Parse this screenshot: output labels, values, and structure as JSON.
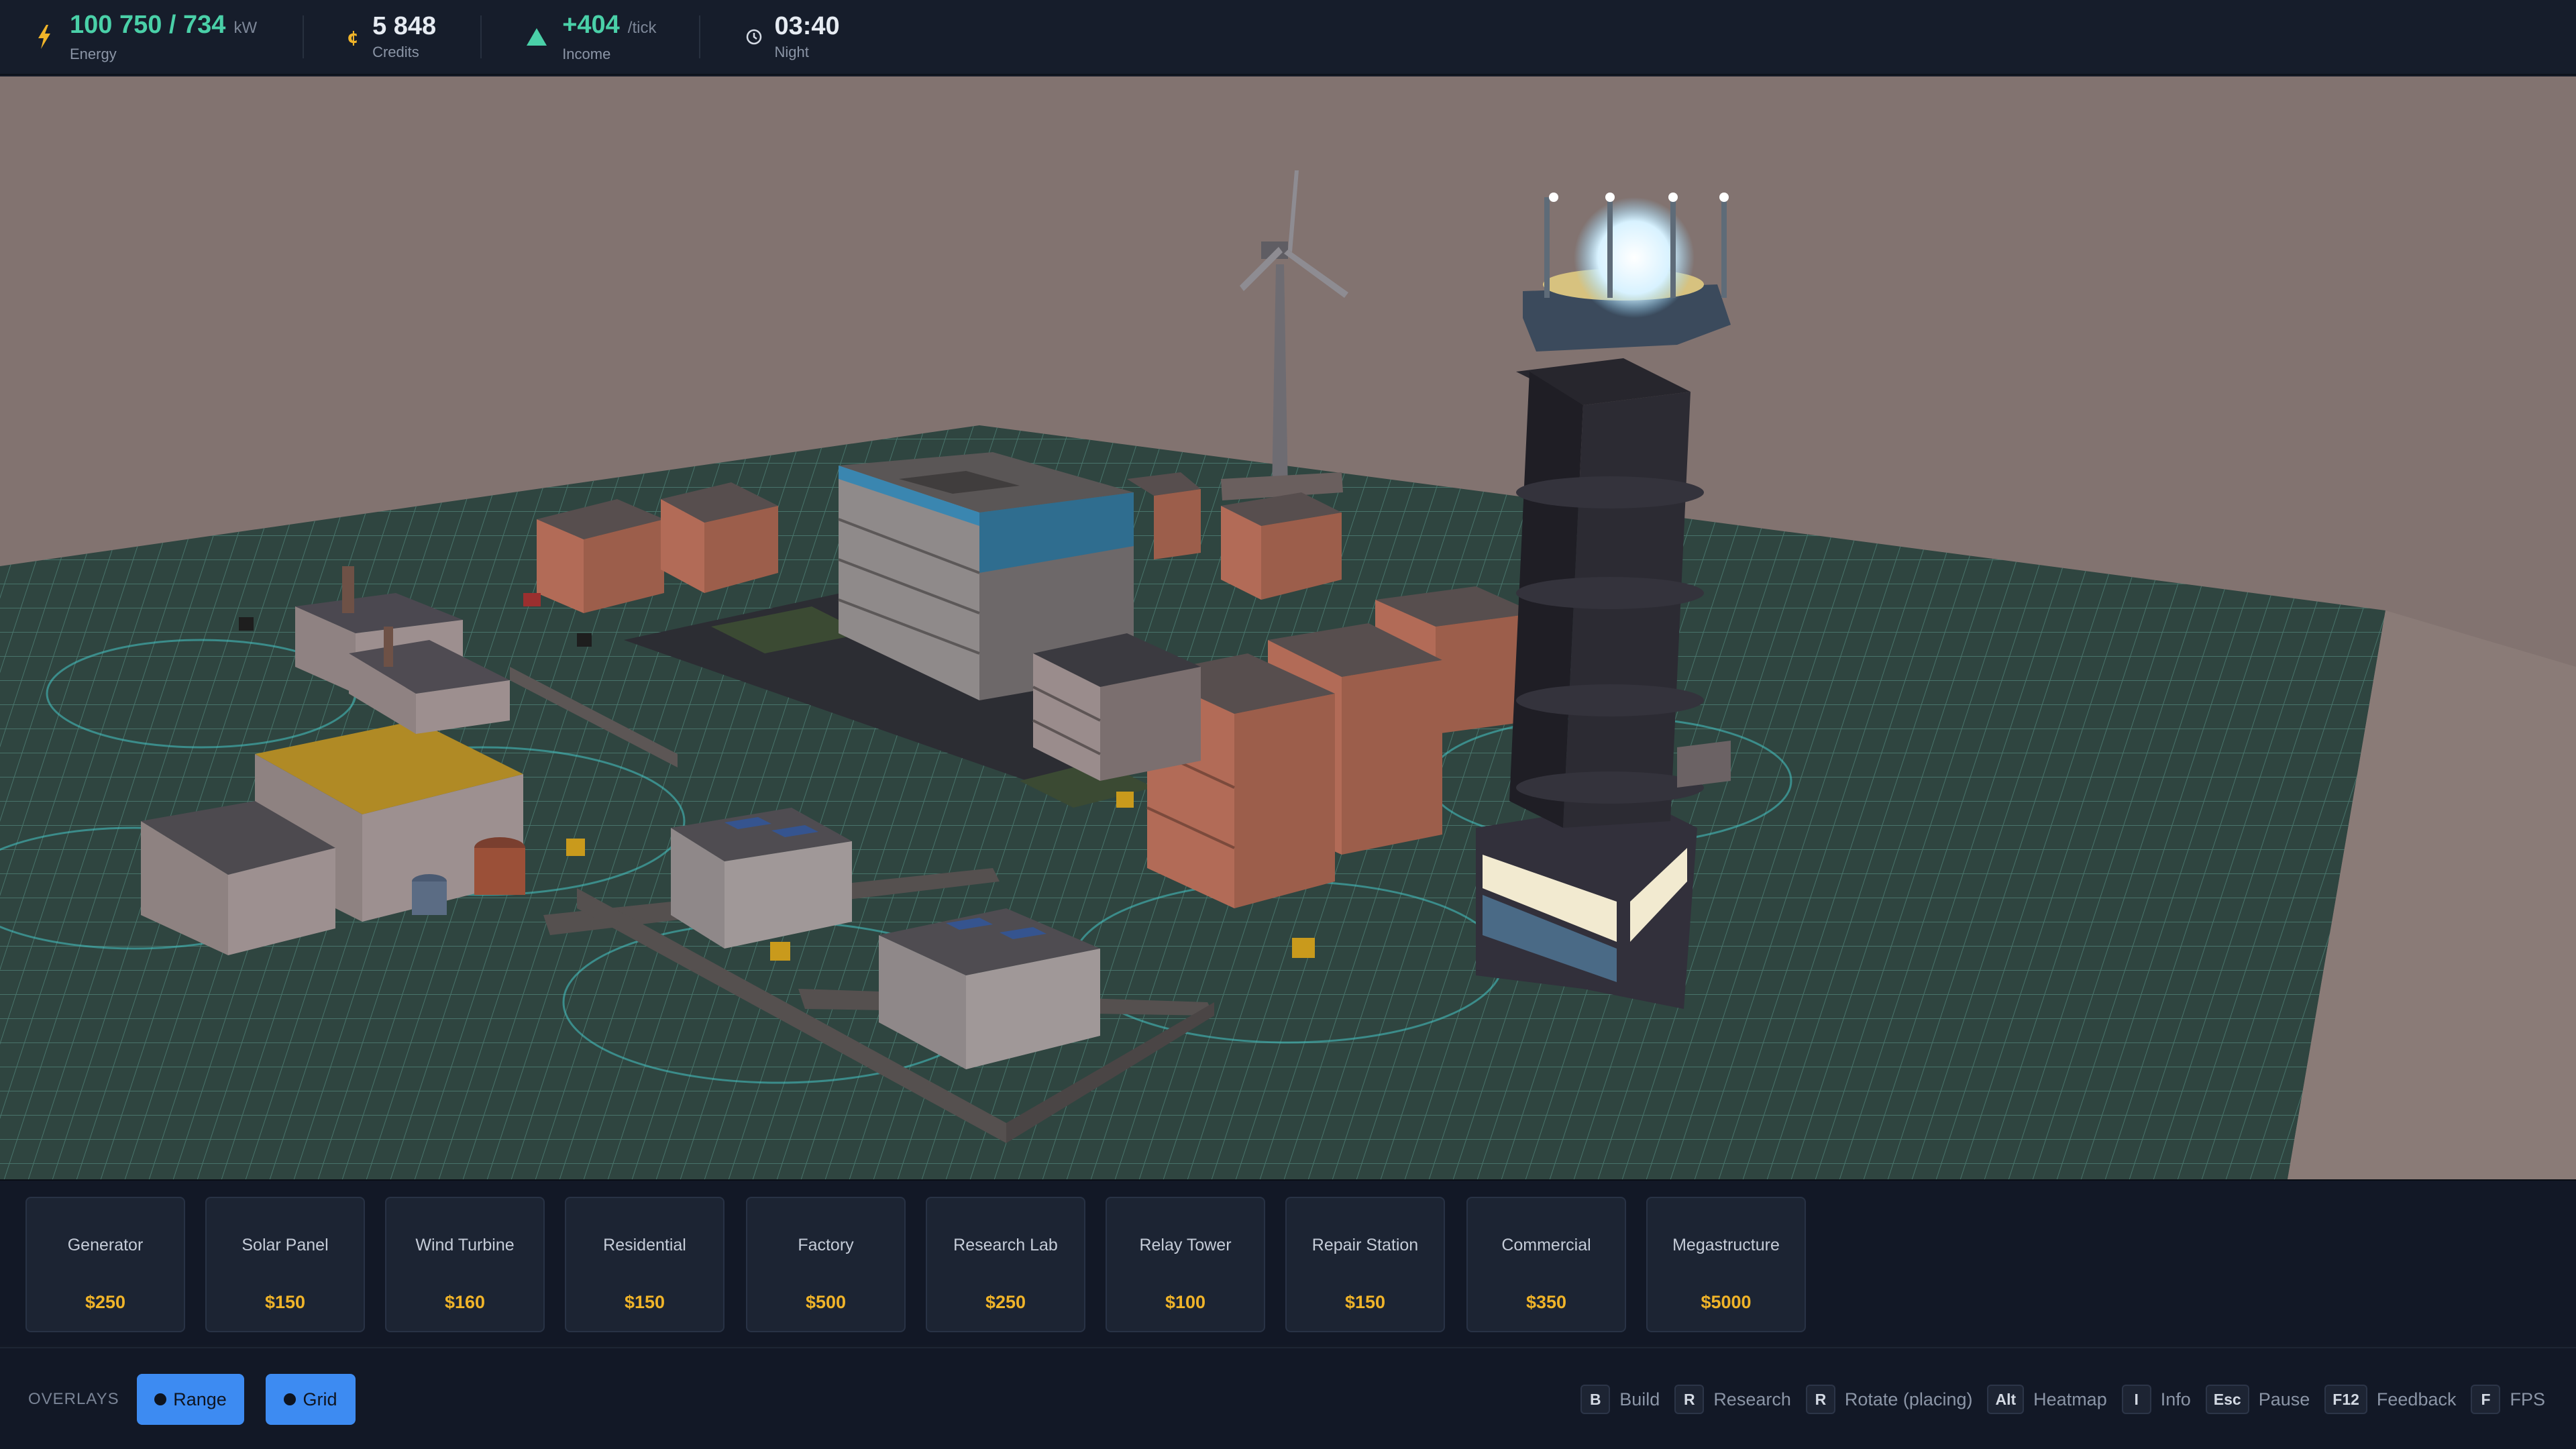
{
  "hud": {
    "energy": {
      "value": "100 750 / 734",
      "unit": "kW",
      "label": "Energy",
      "icon": "lightning-icon"
    },
    "credits": {
      "value": "5 848",
      "label": "Credits",
      "icon": "coin-icon"
    },
    "income": {
      "value": "+404",
      "unit": "/tick",
      "label": "Income",
      "icon": "up-triangle-icon"
    },
    "time": {
      "value": "03:40",
      "label": "Night",
      "icon": "clock-icon"
    }
  },
  "build_menu": [
    {
      "name": "Generator",
      "price": "$250"
    },
    {
      "name": "Solar Panel",
      "price": "$150"
    },
    {
      "name": "Wind Turbine",
      "price": "$160"
    },
    {
      "name": "Residential",
      "price": "$150"
    },
    {
      "name": "Factory",
      "price": "$500"
    },
    {
      "name": "Research Lab",
      "price": "$250"
    },
    {
      "name": "Relay Tower",
      "price": "$100"
    },
    {
      "name": "Repair Station",
      "price": "$150"
    },
    {
      "name": "Commercial",
      "price": "$350"
    },
    {
      "name": "Megastructure",
      "price": "$5000"
    }
  ],
  "overlays": {
    "label": "OVERLAYS",
    "range": "Range",
    "grid": "Grid"
  },
  "shortcuts": [
    {
      "key": "B",
      "label": "Build"
    },
    {
      "key": "R",
      "label": "Research"
    },
    {
      "key": "R",
      "label": "Rotate (placing)"
    },
    {
      "key": "Alt",
      "label": "Heatmap"
    },
    {
      "key": "I",
      "label": "Info"
    },
    {
      "key": "Esc",
      "label": "Pause"
    },
    {
      "key": "F12",
      "label": "Feedback"
    },
    {
      "key": "F",
      "label": "FPS"
    }
  ],
  "colors": {
    "accent_green": "#4ad0a8",
    "price_gold": "#f0b429",
    "overlay_button_blue": "#3d8bf2",
    "sky": "#827370",
    "ground": "#2f4440"
  }
}
